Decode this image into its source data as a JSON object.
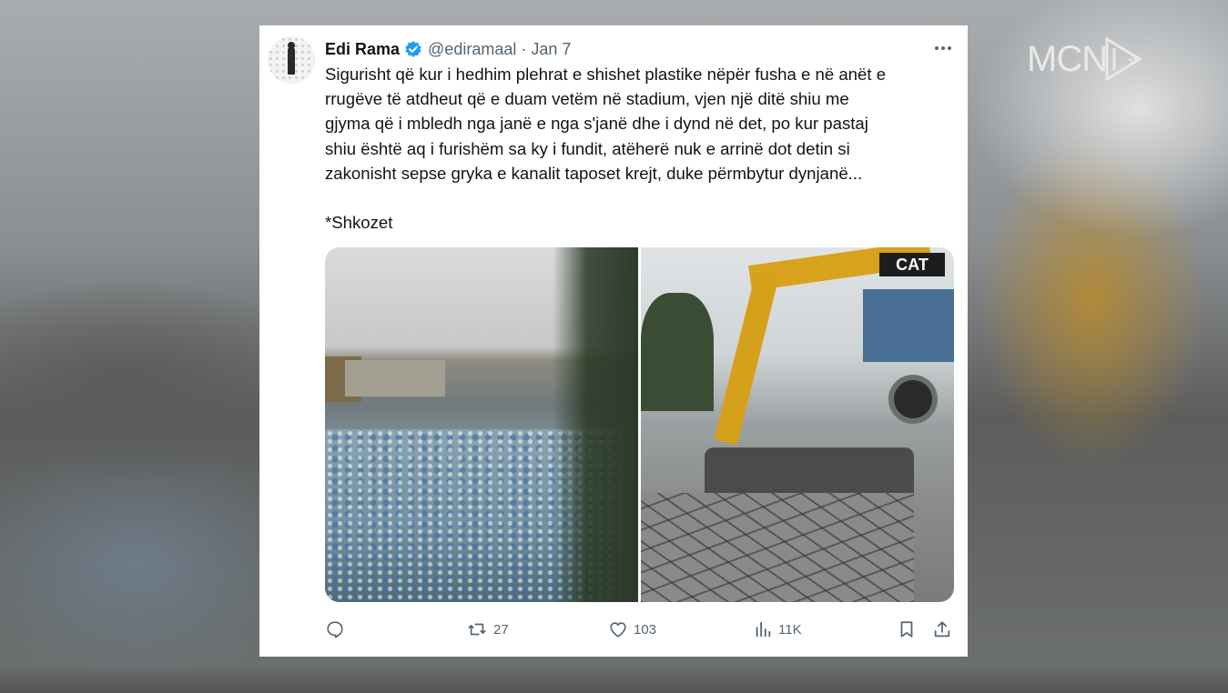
{
  "overlay": {
    "logo_text": "MCN",
    "logo_sub": "tv"
  },
  "tweet": {
    "author_name": "Edi Rama",
    "handle": "@ediramaal",
    "separator": "·",
    "date": "Jan 7",
    "body": "Sigurisht që kur i hedhim plehrat e shishet plastike nëpër fusha e në anët e\nrrugëve të atdheut që e duam vetëm në stadium, vjen një ditë shiu me\ngjyma që i mbledh nga janë e nga s'janë dhe i dynd në det, po kur pastaj\nshiu është aq i furishëm sa ky i fundit, atëherë nuk e arrinë dot detin si\nzakonisht sepse gryka e kanalit taposet krejt, duke përmbytur dynjanë...",
    "tag": "*Shkozet",
    "media": [
      {
        "description_icon": "photo-plastic-waste-canal"
      },
      {
        "description_icon": "photo-excavator-roadwork",
        "brand_text": "CAT"
      }
    ],
    "actions": {
      "reply_count": "",
      "retweet_count": "27",
      "like_count": "103",
      "views_count": "11K"
    }
  },
  "colors": {
    "text_primary": "#0f1419",
    "text_secondary": "#536471",
    "verified_blue": "#1d9bf0",
    "card_background": "#ffffff"
  }
}
